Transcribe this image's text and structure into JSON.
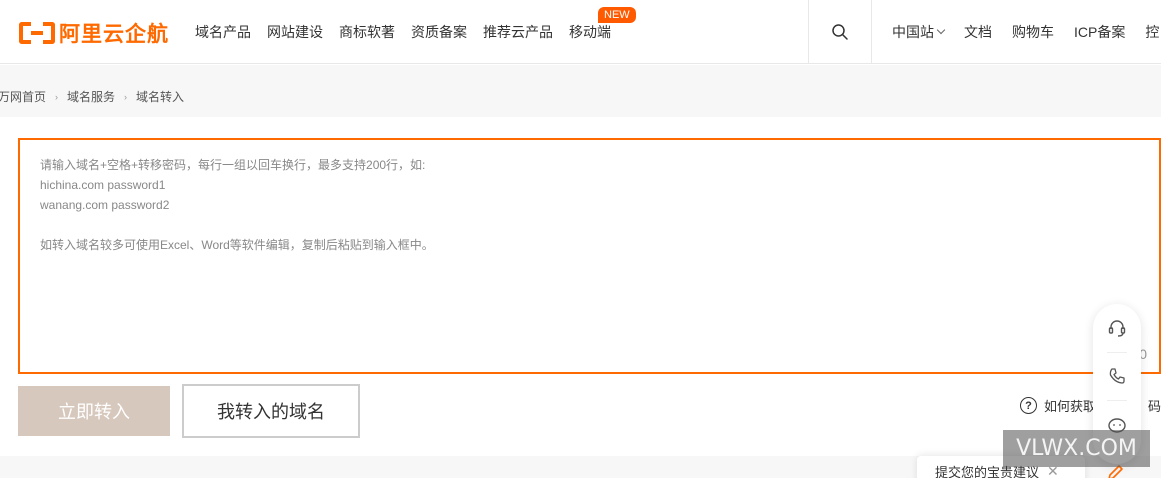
{
  "header": {
    "logo_text": "阿里云企航",
    "nav_items": [
      "域名产品",
      "网站建设",
      "商标软著",
      "资质备案",
      "推荐云产品",
      "移动端"
    ],
    "new_badge": "NEW",
    "right_nav": {
      "region": "中国站",
      "docs": "文档",
      "cart": "购物车",
      "icp": "ICP备案",
      "cut_off": "控"
    },
    "icons": {
      "search": "search-icon",
      "region_dropdown": "chevron-down-icon"
    }
  },
  "breadcrumb": [
    "万网首页",
    "域名服务",
    "域名转入"
  ],
  "breadcrumb_separator": "›",
  "transfer_input": {
    "placeholder_lines": [
      "请输入域名+空格+转移密码，每行一组以回车换行，最多支持200行，如:",
      "hichina.com password1",
      "wanang.com password2",
      "",
      "如转入域名较多可使用Excel、Word等软件编辑，复制后粘贴到输入框中。"
    ],
    "counter": "0"
  },
  "buttons": {
    "transfer_now": "立即转入",
    "my_transfers": "我转入的域名"
  },
  "help_link": {
    "icon": "question-circle-icon",
    "text_visible_start": "如何获取",
    "text_visible_end": "码"
  },
  "floating_toolbar": {
    "icons": [
      "headset-icon",
      "phone-icon",
      "chat-icon"
    ]
  },
  "feedback": {
    "label": "提交您的宝贵建议",
    "icons": [
      "close-icon",
      "pen-icon"
    ]
  },
  "watermark": "VLWX.COM",
  "colors": {
    "brand": "#ff6a00",
    "badge": "#ff5a00",
    "primary_button_disabled": "#d7c8bd",
    "crumb_bg": "#f7f7f7"
  }
}
